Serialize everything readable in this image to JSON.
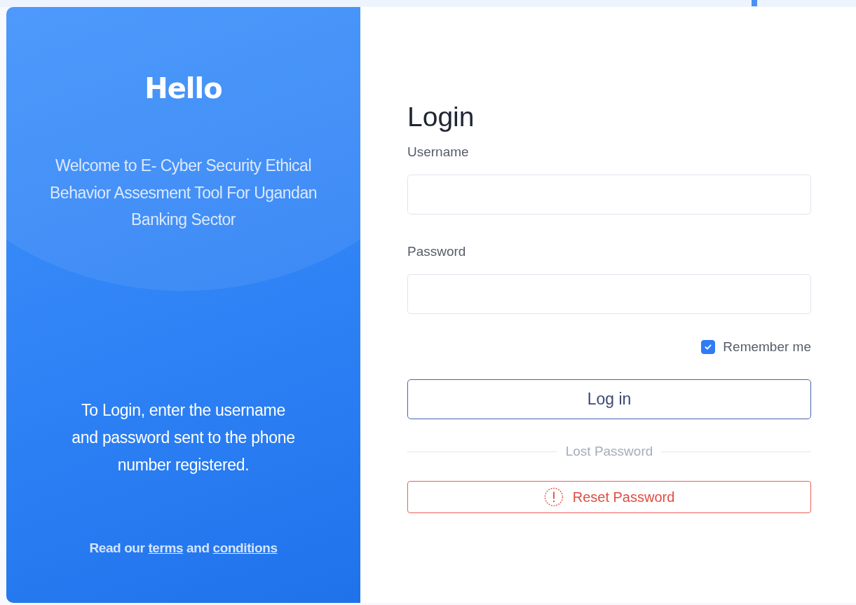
{
  "left_panel": {
    "title": "Hello",
    "welcome": "Welcome to E- Cyber Security Ethical Behavior Assesment Tool For Ugandan Banking Sector",
    "instructions": "To Login, enter the username and password sent to the phone number registered.",
    "terms": {
      "prefix": "Read our",
      "link_1": "terms",
      "middle": "and",
      "link_2": "conditions"
    }
  },
  "form": {
    "title": "Login",
    "fields": [
      {
        "label": "Username"
      },
      {
        "label": "Password"
      }
    ],
    "remember": {
      "label": "Remember me",
      "checked": true
    },
    "login_button": "Log in",
    "divider_label": "Lost Password",
    "reset_button": "Reset Password"
  }
}
